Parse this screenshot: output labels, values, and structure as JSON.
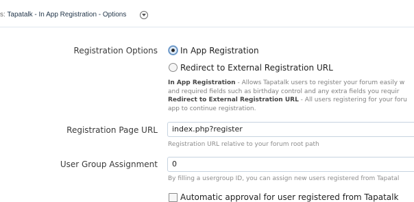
{
  "header": {
    "breadcrumb_prefix": "s:",
    "breadcrumb": "Tapatalk - In App Registration - Options"
  },
  "form": {
    "registration_options": {
      "label": "Registration Options",
      "options": [
        {
          "label": "In App Registration",
          "selected": true
        },
        {
          "label": "Redirect to External Registration URL",
          "selected": false
        }
      ],
      "description": {
        "line1_bold": "In App Registration",
        "line1_rest": " - Allows Tapatalk users to register your forum easily w",
        "line2": "and required fields such as birthday control and any extra fields you requir",
        "line3_bold": "Redirect to External Registration URL",
        "line3_rest": " - All users registering for your foru",
        "line4": "app to continue registration."
      }
    },
    "registration_url": {
      "label": "Registration Page URL",
      "value": "index.php?register",
      "hint": "Registration URL relative to your forum root path"
    },
    "user_group": {
      "label": "User Group Assignment",
      "value": "0",
      "hint": "By filling a usergroup ID, you can assign new users registered from Tapatal"
    },
    "auto_approval": {
      "label": "Automatic approval for user registered from Tapatalk",
      "checked": false
    }
  }
}
